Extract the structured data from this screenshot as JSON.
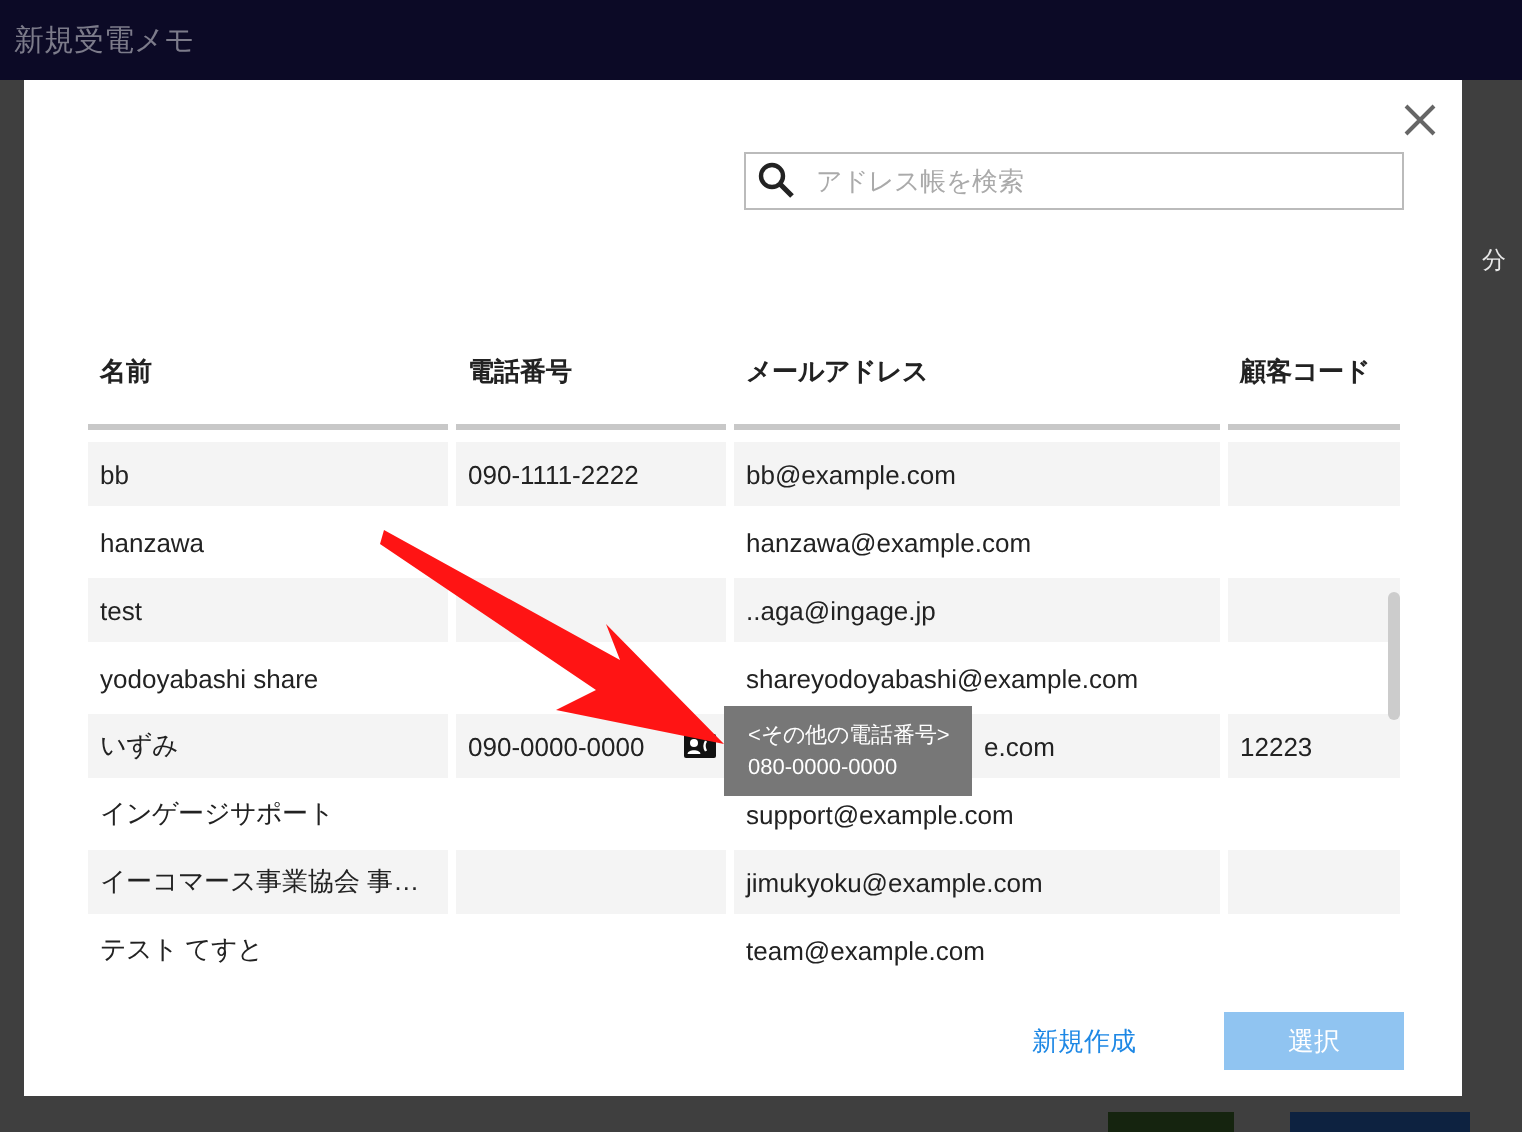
{
  "window": {
    "title": "新規受電メモ"
  },
  "background": {
    "label": "分"
  },
  "dialog": {
    "search": {
      "placeholder": "アドレス帳を検索"
    },
    "columns": [
      "名前",
      "電話番号",
      "メールアドレス",
      "顧客コード"
    ],
    "rows": [
      {
        "name": "bb",
        "phone": "090-1111-2222",
        "email": "bb@example.com",
        "code": ""
      },
      {
        "name": "hanzawa",
        "phone": "",
        "email": "hanzawa@example.com",
        "code": ""
      },
      {
        "name": "test",
        "phone": "",
        "email": "..aga@ingage.jp",
        "code": ""
      },
      {
        "name": "yodoyabashi share",
        "phone": "",
        "email": "shareyodoyabashi@example.com",
        "code": ""
      },
      {
        "name": "いずみ",
        "phone": "090-0000-0000",
        "email": "e.com",
        "code": "12223",
        "tooltip": {
          "title": "<その他の電話番号>",
          "value": "080-0000-0000"
        }
      },
      {
        "name": "インゲージサポート",
        "phone": "",
        "email": "support@example.com",
        "code": ""
      },
      {
        "name": "イーコマース事業協会 事…",
        "phone": "",
        "email": "jimukyoku@example.com",
        "code": ""
      },
      {
        "name": "テスト てすと",
        "phone": "",
        "email": "team@example.com",
        "code": ""
      }
    ],
    "buttons": {
      "create": "新規作成",
      "select": "選択"
    }
  }
}
